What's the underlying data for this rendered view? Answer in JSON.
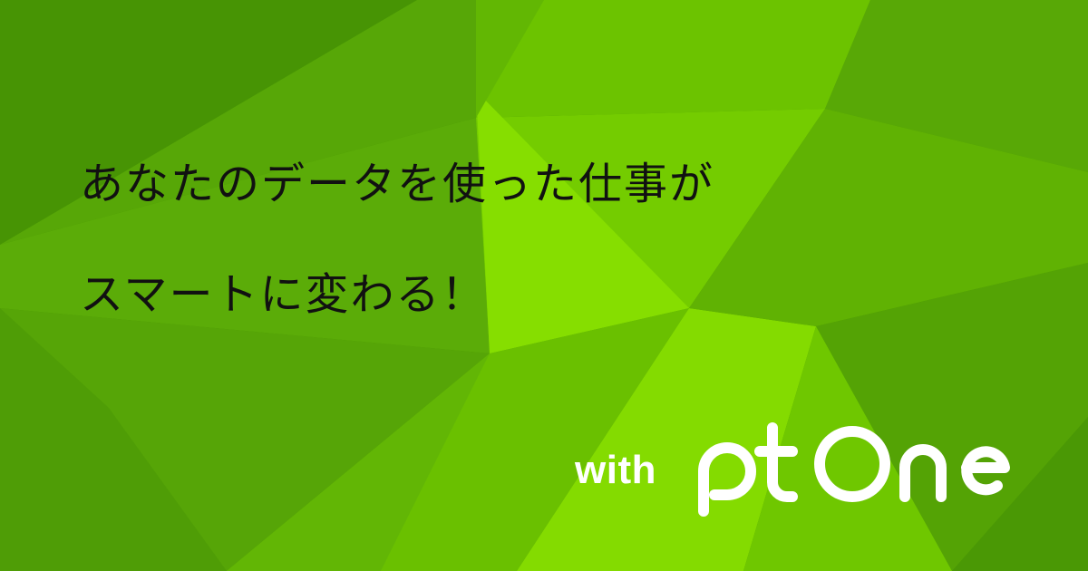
{
  "headline": {
    "line1": "あなたのデータを使った仕事が",
    "line2": "スマートに変わる！"
  },
  "brand": {
    "with_text": "with",
    "logo_text": "Pt One",
    "logo_color": "#ffffff"
  },
  "palette": {
    "background": "#4c9a06",
    "facet_dark": "#3f8a04",
    "facet_mid": "#5aaa08",
    "facet_light": "#7ed600",
    "facet_bright": "#8fe400",
    "text": "#111111"
  }
}
